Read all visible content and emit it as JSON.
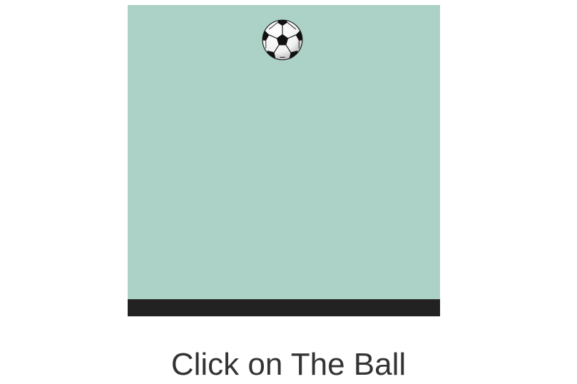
{
  "game": {
    "ball_icon": "soccer-ball-icon",
    "instruction": "Click on The Ball"
  },
  "colors": {
    "field": "#acd1c6",
    "ground": "#222222",
    "text": "#333333"
  }
}
